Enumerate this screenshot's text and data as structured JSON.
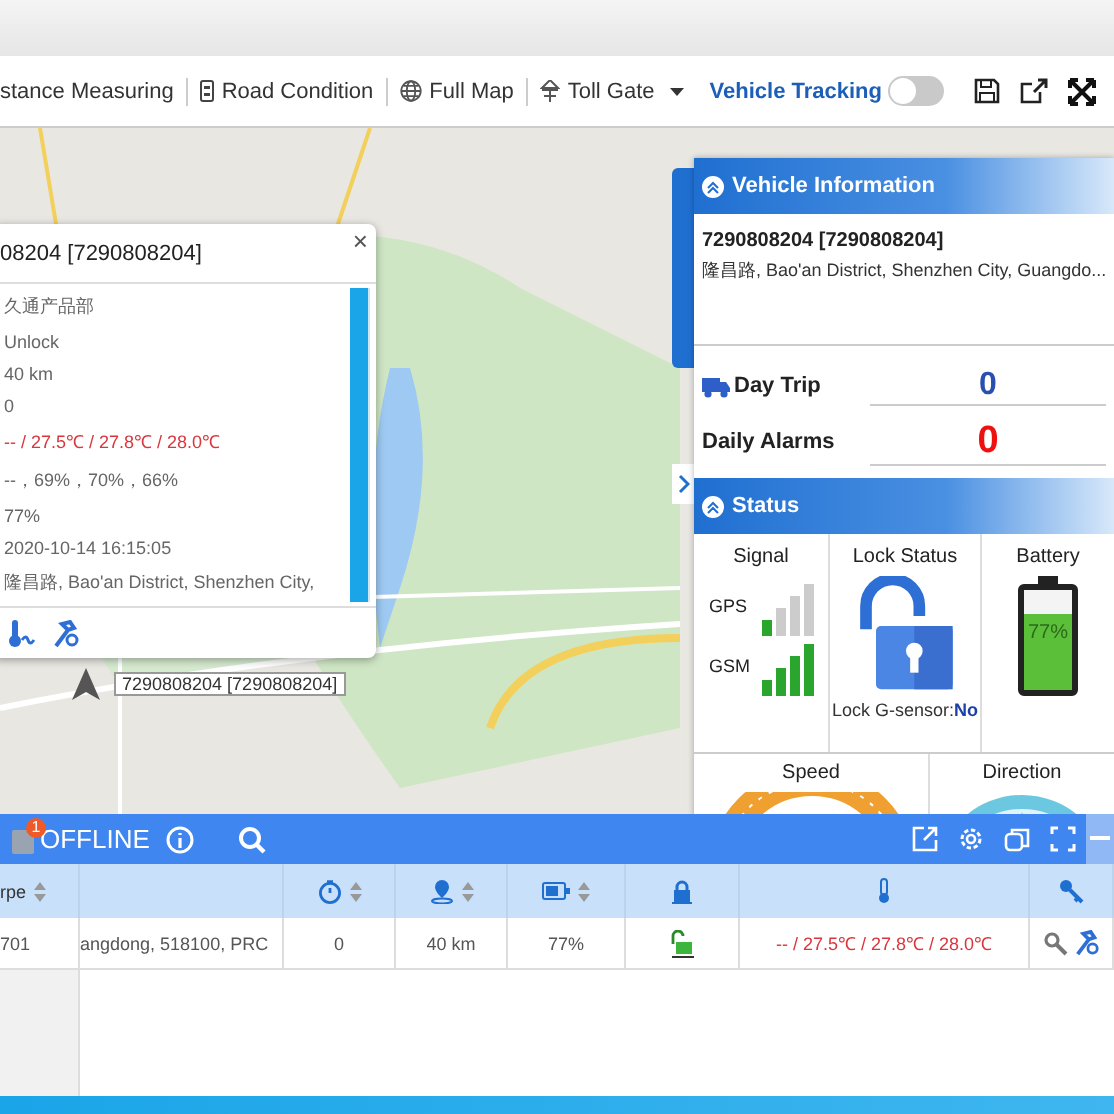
{
  "toolbar": {
    "items": [
      {
        "kind": "none",
        "label": "stance Measuring",
        "dropdown": false
      },
      {
        "kind": "road",
        "label": "Road Condition",
        "dropdown": false
      },
      {
        "kind": "globe",
        "label": "Full Map",
        "dropdown": false
      },
      {
        "kind": "toll",
        "label": "Toll Gate",
        "dropdown": true
      }
    ],
    "tracking": {
      "label": "Vehicle Tracking",
      "on": false
    }
  },
  "popup": {
    "title": "08204 [7290808204]",
    "close": "×",
    "lines": [
      {
        "kind": "text",
        "text": "久通产品部"
      },
      {
        "kind": "text",
        "text": "Unlock"
      },
      {
        "kind": "text",
        "text": "40 km"
      },
      {
        "kind": "text",
        "text": "0"
      },
      {
        "kind": "temperature",
        "text": "-- / 27.5℃ / 27.8℃ / 28.0℃"
      },
      {
        "kind": "text",
        "text": "--，69%，70%，66%"
      },
      {
        "kind": "text",
        "text": "77%"
      },
      {
        "kind": "text",
        "text": "2020-10-14 16:15:05"
      },
      {
        "kind": "text",
        "text": "隆昌路, Bao'an District, Shenzhen City,"
      }
    ]
  },
  "marker": {
    "label": "7290808204 [7290808204]"
  },
  "vehicle_info": {
    "title": "Vehicle Information",
    "id": "7290808204 [7290808204]",
    "address": "隆昌路, Bao'an District, Shenzhen City, Guangdo...",
    "stats": [
      {
        "kind": "trip",
        "label": "Day Trip",
        "value": "0"
      },
      {
        "kind": "alarm",
        "label": "Daily Alarms",
        "value": "0"
      }
    ]
  },
  "status": {
    "title": "Status",
    "signal": {
      "title": "Signal",
      "rows": [
        {
          "label": "GPS",
          "bars": [
            {
              "on": true
            },
            {
              "on": false
            },
            {
              "on": false
            },
            {
              "on": false
            }
          ]
        },
        {
          "label": "GSM",
          "bars": [
            {
              "on": true
            },
            {
              "on": true
            },
            {
              "on": true
            },
            {
              "on": true
            }
          ]
        }
      ]
    },
    "lock": {
      "title": "Lock Status",
      "locked": false,
      "sensor_label": "Lock G-sensor:",
      "sensor_value": "No"
    },
    "battery": {
      "title": "Battery",
      "level": 0.77,
      "reading": "77%"
    },
    "speed": {
      "title": "Speed"
    },
    "direction": {
      "title": "Direction"
    }
  },
  "bottom_bar": {
    "badge": "1",
    "label": "OFFLINE"
  },
  "table": {
    "columns": [
      {
        "kind": "text",
        "label": "rpe",
        "sortable": true
      },
      {
        "kind": "blank",
        "sortable": false
      },
      {
        "kind": "timer",
        "sortable": true
      },
      {
        "kind": "location",
        "sortable": true
      },
      {
        "kind": "battery",
        "sortable": true
      },
      {
        "kind": "lock",
        "sortable": false
      },
      {
        "kind": "temperature",
        "sortable": false
      },
      {
        "kind": "key",
        "sortable": false
      }
    ],
    "rows": [
      {
        "cells": [
          {
            "kind": "text",
            "text": "701"
          },
          {
            "kind": "text",
            "text": "angdong, 518100, PRC"
          },
          {
            "kind": "text",
            "text": "0"
          },
          {
            "kind": "text",
            "text": "40 km"
          },
          {
            "kind": "text",
            "text": "77%"
          },
          {
            "kind": "lock",
            "locked": false
          },
          {
            "kind": "temperature",
            "text": "-- / 27.5℃ / 27.8℃ / 28.0℃"
          },
          {
            "kind": "tools"
          }
        ]
      }
    ]
  }
}
